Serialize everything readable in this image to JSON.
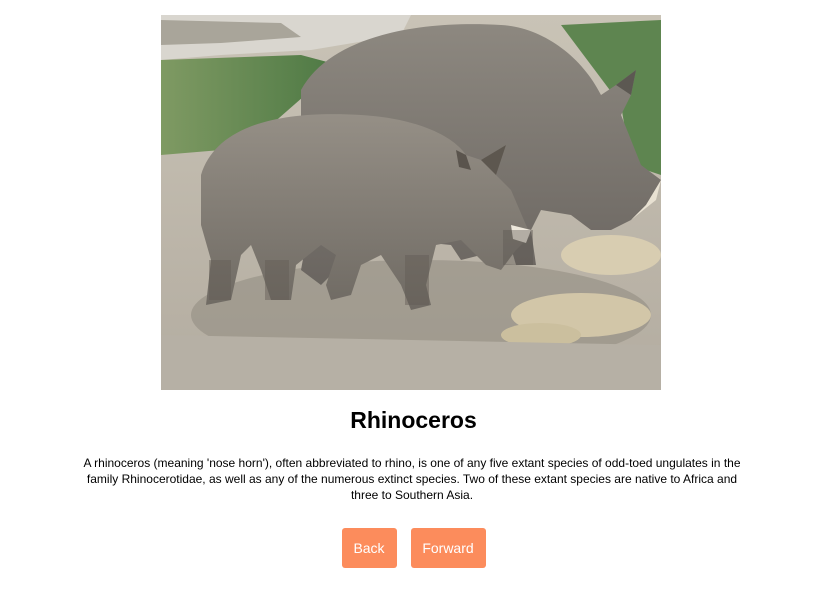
{
  "photo": {
    "subject": "two rhinoceroses grazing on straw"
  },
  "article": {
    "title": "Rhinoceros",
    "description": "A rhinoceros (meaning 'nose horn'), often abbreviated to rhino, is one of any five extant species of odd-toed ungulates in the family Rhinocerotidae, as well as any of the numerous extinct species. Two of these extant species are native to Africa and three to Southern Asia."
  },
  "navigation": {
    "back_label": "Back",
    "forward_label": "Forward"
  },
  "colors": {
    "button_background": "#fc8c5c",
    "button_text": "#ffffff",
    "page_background": "#ffffff",
    "text": "#000000"
  }
}
